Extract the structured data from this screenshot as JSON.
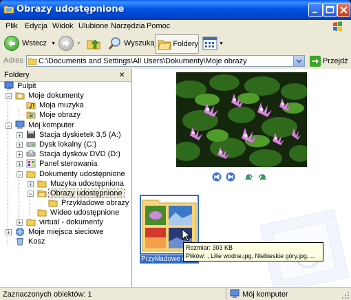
{
  "window": {
    "title": "Obrazy udostępnione"
  },
  "menu": [
    "Plik",
    "Edycja",
    "Widok",
    "Ulubione",
    "Narzędzia",
    "Pomoc"
  ],
  "toolbar": {
    "back": "Wstecz",
    "search": "Wyszukaj",
    "folders": "Foldery"
  },
  "address": {
    "label": "Adres",
    "value": "C:\\Documents and Settings\\All Users\\Dokumenty\\Moje obrazy",
    "go": "Przejdź"
  },
  "panel": {
    "title": "Foldery",
    "close": "×"
  },
  "tree": [
    {
      "label": "Pulpit"
    },
    {
      "label": "Moje dokumenty",
      "exp": "−"
    },
    {
      "label": "Moja muzyka"
    },
    {
      "label": "Moje obrazy"
    },
    {
      "label": "Mój komputer",
      "exp": "−"
    },
    {
      "label": "Stacja dyskietek 3,5 (A:)",
      "exp": "+"
    },
    {
      "label": "Dysk lokalny (C:)",
      "exp": "+"
    },
    {
      "label": "Stacja dysków DVD (D:)",
      "exp": "+"
    },
    {
      "label": "Panel sterowania",
      "exp": "+"
    },
    {
      "label": "Dokumenty udostępnione",
      "exp": "−"
    },
    {
      "label": "Muzyka udostępniona",
      "exp": "+"
    },
    {
      "label": "Obrazy udostępnione",
      "exp": "−"
    },
    {
      "label": "Przykładowe obrazy"
    },
    {
      "label": "Wideo udostępnione"
    },
    {
      "label": "virtual - dokumenty",
      "exp": "+"
    },
    {
      "label": "Moje miejsca sieciowe",
      "exp": "+"
    },
    {
      "label": "Kosz"
    }
  ],
  "folder_item": {
    "label": "Przykładowe ob"
  },
  "tooltip": {
    "line1": "Rozmiar: 303 KB",
    "line2": "Plików: , Lilie wodne.jpg, Niebieskie góry.jpg, ..."
  },
  "status": {
    "left": "Zaznaczonych obiektów: 1",
    "right": "Mój komputer"
  }
}
